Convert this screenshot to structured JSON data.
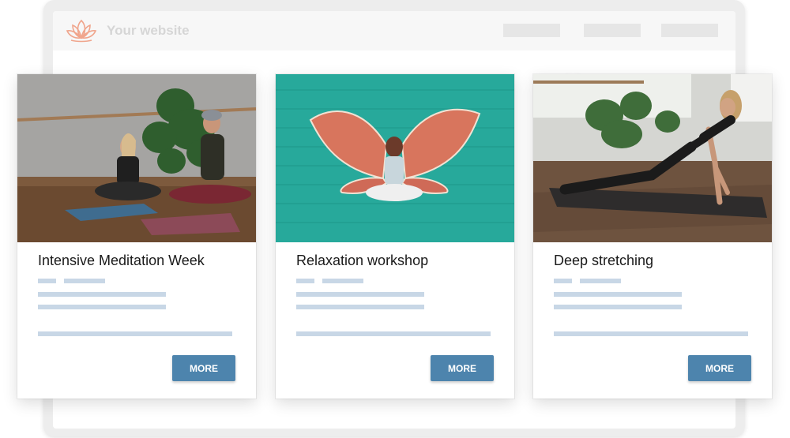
{
  "site": {
    "title": "Your website",
    "logo_icon": "lotus-icon",
    "nav_items": [
      "",
      "",
      ""
    ]
  },
  "cards": [
    {
      "title": "Intensive Meditation Week",
      "button_label": "MORE",
      "image": "couple-meditating-photo"
    },
    {
      "title": "Relaxation workshop",
      "button_label": "MORE",
      "image": "woman-with-painted-wings-photo"
    },
    {
      "title": "Deep stretching",
      "button_label": "MORE",
      "image": "woman-stretching-photo"
    }
  ],
  "colors": {
    "accent": "#4d84ad",
    "placeholder_bar": "#c8d7e6",
    "logo": "#f0a58c"
  }
}
